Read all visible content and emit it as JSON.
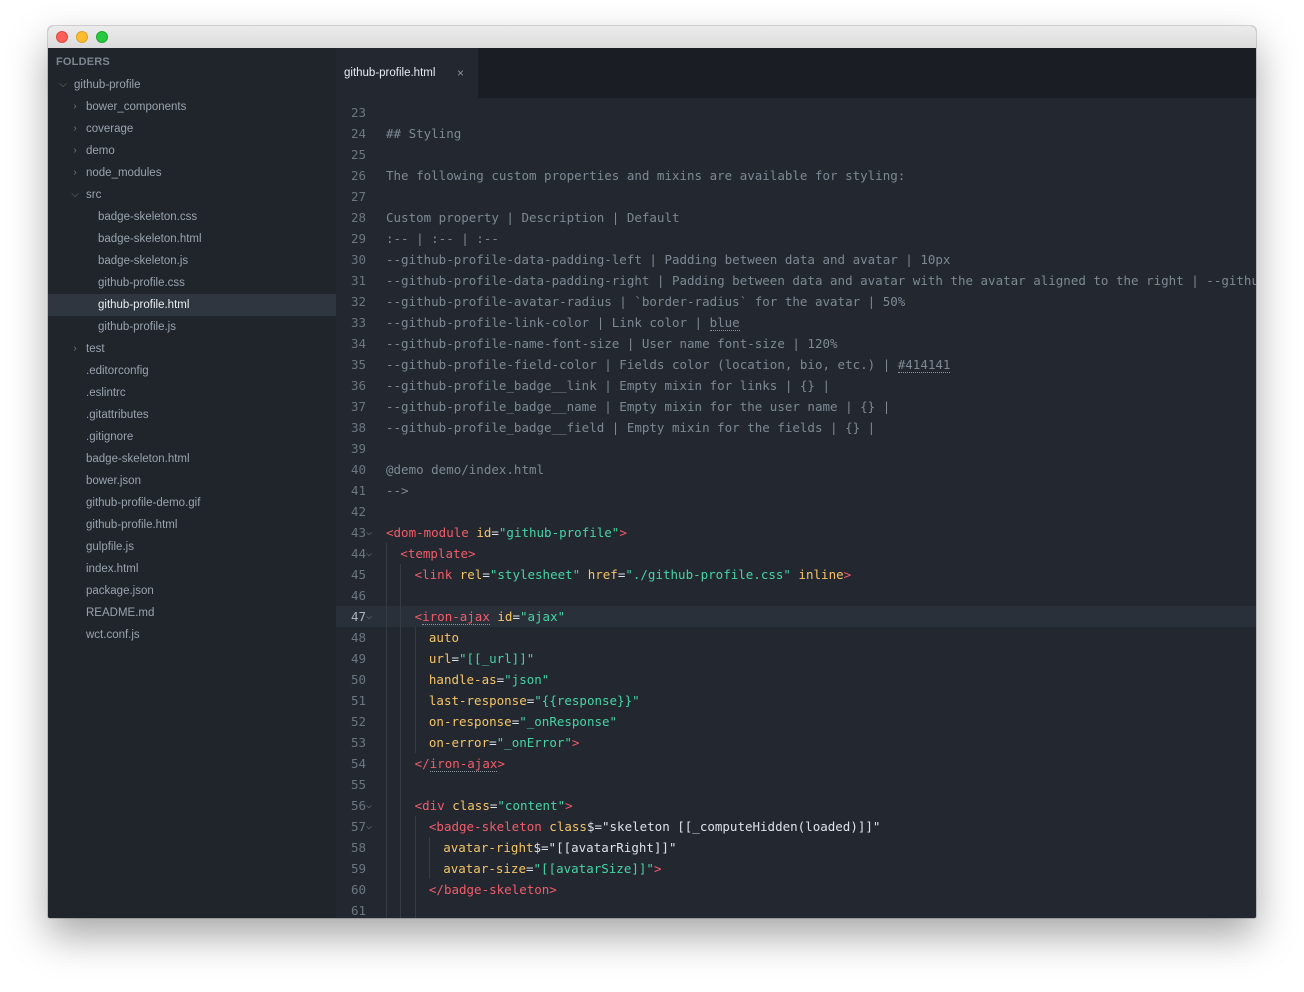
{
  "window": {
    "traffic_lights": [
      "close",
      "minimize",
      "zoom"
    ]
  },
  "sidebar": {
    "header": "FOLDERS",
    "items": [
      {
        "label": "github-profile",
        "depth": 0,
        "type": "folder-open"
      },
      {
        "label": "bower_components",
        "depth": 1,
        "type": "folder-closed"
      },
      {
        "label": "coverage",
        "depth": 1,
        "type": "folder-closed"
      },
      {
        "label": "demo",
        "depth": 1,
        "type": "folder-closed"
      },
      {
        "label": "node_modules",
        "depth": 1,
        "type": "folder-closed"
      },
      {
        "label": "src",
        "depth": 1,
        "type": "folder-open"
      },
      {
        "label": "badge-skeleton.css",
        "depth": 2,
        "type": "file"
      },
      {
        "label": "badge-skeleton.html",
        "depth": 2,
        "type": "file"
      },
      {
        "label": "badge-skeleton.js",
        "depth": 2,
        "type": "file"
      },
      {
        "label": "github-profile.css",
        "depth": 2,
        "type": "file"
      },
      {
        "label": "github-profile.html",
        "depth": 2,
        "type": "file",
        "selected": true
      },
      {
        "label": "github-profile.js",
        "depth": 2,
        "type": "file"
      },
      {
        "label": "test",
        "depth": 1,
        "type": "folder-closed"
      },
      {
        "label": ".editorconfig",
        "depth": 1,
        "type": "file"
      },
      {
        "label": ".eslintrc",
        "depth": 1,
        "type": "file"
      },
      {
        "label": ".gitattributes",
        "depth": 1,
        "type": "file"
      },
      {
        "label": ".gitignore",
        "depth": 1,
        "type": "file"
      },
      {
        "label": "badge-skeleton.html",
        "depth": 1,
        "type": "file"
      },
      {
        "label": "bower.json",
        "depth": 1,
        "type": "file"
      },
      {
        "label": "github-profile-demo.gif",
        "depth": 1,
        "type": "file"
      },
      {
        "label": "github-profile.html",
        "depth": 1,
        "type": "file"
      },
      {
        "label": "gulpfile.js",
        "depth": 1,
        "type": "file"
      },
      {
        "label": "index.html",
        "depth": 1,
        "type": "file"
      },
      {
        "label": "package.json",
        "depth": 1,
        "type": "file"
      },
      {
        "label": "README.md",
        "depth": 1,
        "type": "file"
      },
      {
        "label": "wct.conf.js",
        "depth": 1,
        "type": "file"
      }
    ]
  },
  "tabs": [
    {
      "label": "github-profile.html",
      "close_icon": "×",
      "active": true
    }
  ],
  "editor": {
    "current_line": 47,
    "lines": [
      {
        "n": "23",
        "indent": 0,
        "tokens": []
      },
      {
        "n": "24",
        "indent": 0,
        "tokens": [
          {
            "t": "## Styling",
            "c": "comment"
          }
        ]
      },
      {
        "n": "25",
        "indent": 0,
        "tokens": []
      },
      {
        "n": "26",
        "indent": 0,
        "tokens": [
          {
            "t": "The following custom properties and mixins are available for styling:",
            "c": "comment"
          }
        ]
      },
      {
        "n": "27",
        "indent": 0,
        "tokens": []
      },
      {
        "n": "28",
        "indent": 0,
        "tokens": [
          {
            "t": "Custom property | Description | Default",
            "c": "comment"
          }
        ]
      },
      {
        "n": "29",
        "indent": 0,
        "tokens": [
          {
            "t": ":-- | :-- | :--",
            "c": "comment"
          }
        ]
      },
      {
        "n": "30",
        "indent": 0,
        "tokens": [
          {
            "t": "--github-profile-data-padding-left | Padding between data and avatar | 10px",
            "c": "comment"
          }
        ]
      },
      {
        "n": "31",
        "indent": 0,
        "tokens": [
          {
            "t": "--github-profile-data-padding-right | Padding between data and avatar with the avatar aligned to the right | --github-pro",
            "c": "comment"
          }
        ]
      },
      {
        "n": "32",
        "indent": 0,
        "tokens": [
          {
            "t": "--github-profile-avatar-radius | `border-radius` for the avatar | 50%",
            "c": "comment"
          }
        ]
      },
      {
        "n": "33",
        "indent": 0,
        "tokens": [
          {
            "t": "--github-profile-link-color | Link color | ",
            "c": "comment"
          },
          {
            "t": "blue",
            "c": "comment-u"
          }
        ]
      },
      {
        "n": "34",
        "indent": 0,
        "tokens": [
          {
            "t": "--github-profile-name-font-size | User name font-size | 120%",
            "c": "comment"
          }
        ]
      },
      {
        "n": "35",
        "indent": 0,
        "tokens": [
          {
            "t": "--github-profile-field-color | Fields color (location, bio, etc.) | ",
            "c": "comment"
          },
          {
            "t": "#414141",
            "c": "comment-u"
          }
        ]
      },
      {
        "n": "36",
        "indent": 0,
        "tokens": [
          {
            "t": "--github-profile_badge__link | Empty mixin for links | {} |",
            "c": "comment"
          }
        ]
      },
      {
        "n": "37",
        "indent": 0,
        "tokens": [
          {
            "t": "--github-profile_badge__name | Empty mixin for the user name | {} |",
            "c": "comment"
          }
        ]
      },
      {
        "n": "38",
        "indent": 0,
        "tokens": [
          {
            "t": "--github-profile_badge__field | Empty mixin for the fields | {} |",
            "c": "comment"
          }
        ]
      },
      {
        "n": "39",
        "indent": 0,
        "tokens": []
      },
      {
        "n": "40",
        "indent": 0,
        "tokens": [
          {
            "t": "@demo demo/index.html",
            "c": "comment"
          }
        ]
      },
      {
        "n": "41",
        "indent": 0,
        "tokens": [
          {
            "t": "-->",
            "c": "comment"
          }
        ]
      },
      {
        "n": "42",
        "indent": 0,
        "tokens": []
      },
      {
        "n": "43",
        "indent": 0,
        "fold": true,
        "tokens": [
          {
            "t": "<dom-module",
            "c": "tag"
          },
          {
            "t": " id",
            "c": "attr"
          },
          {
            "t": "=",
            "c": "plain"
          },
          {
            "t": "\"github-profile\"",
            "c": "str"
          },
          {
            "t": ">",
            "c": "tag"
          }
        ]
      },
      {
        "n": "44",
        "indent": 1,
        "fold": true,
        "tokens": [
          {
            "t": "<template>",
            "c": "tag"
          }
        ]
      },
      {
        "n": "45",
        "indent": 2,
        "tokens": [
          {
            "t": "<link",
            "c": "tag"
          },
          {
            "t": " rel",
            "c": "attr"
          },
          {
            "t": "=",
            "c": "plain"
          },
          {
            "t": "\"stylesheet\"",
            "c": "str"
          },
          {
            "t": " href",
            "c": "attr"
          },
          {
            "t": "=",
            "c": "plain"
          },
          {
            "t": "\"./github-profile.css\"",
            "c": "str"
          },
          {
            "t": " inline",
            "c": "attr"
          },
          {
            "t": ">",
            "c": "tag"
          }
        ]
      },
      {
        "n": "46",
        "indent": 2,
        "tokens": []
      },
      {
        "n": "47",
        "indent": 2,
        "fold": true,
        "tokens": [
          {
            "t": "<",
            "c": "tag"
          },
          {
            "t": "iron-ajax",
            "c": "tag-u"
          },
          {
            "t": " id",
            "c": "attr"
          },
          {
            "t": "=",
            "c": "plain"
          },
          {
            "t": "\"ajax\"",
            "c": "str"
          }
        ]
      },
      {
        "n": "48",
        "indent": 3,
        "tokens": [
          {
            "t": "auto",
            "c": "attr"
          }
        ]
      },
      {
        "n": "49",
        "indent": 3,
        "tokens": [
          {
            "t": "url",
            "c": "attr"
          },
          {
            "t": "=",
            "c": "plain"
          },
          {
            "t": "\"[[_url]]\"",
            "c": "str"
          }
        ]
      },
      {
        "n": "50",
        "indent": 3,
        "tokens": [
          {
            "t": "handle-as",
            "c": "attr"
          },
          {
            "t": "=",
            "c": "plain"
          },
          {
            "t": "\"json\"",
            "c": "str"
          }
        ]
      },
      {
        "n": "51",
        "indent": 3,
        "tokens": [
          {
            "t": "last-response",
            "c": "attr"
          },
          {
            "t": "=",
            "c": "plain"
          },
          {
            "t": "\"{{response}}\"",
            "c": "str"
          }
        ]
      },
      {
        "n": "52",
        "indent": 3,
        "tokens": [
          {
            "t": "on-response",
            "c": "attr"
          },
          {
            "t": "=",
            "c": "plain"
          },
          {
            "t": "\"_onResponse\"",
            "c": "str"
          }
        ]
      },
      {
        "n": "53",
        "indent": 3,
        "tokens": [
          {
            "t": "on-error",
            "c": "attr"
          },
          {
            "t": "=",
            "c": "plain"
          },
          {
            "t": "\"_onError\"",
            "c": "str"
          },
          {
            "t": ">",
            "c": "tag"
          }
        ]
      },
      {
        "n": "54",
        "indent": 2,
        "tokens": [
          {
            "t": "</",
            "c": "tag"
          },
          {
            "t": "iron-ajax",
            "c": "tag-u"
          },
          {
            "t": ">",
            "c": "tag"
          }
        ]
      },
      {
        "n": "55",
        "indent": 2,
        "tokens": []
      },
      {
        "n": "56",
        "indent": 2,
        "fold": true,
        "tokens": [
          {
            "t": "<div",
            "c": "tag"
          },
          {
            "t": " class",
            "c": "attr"
          },
          {
            "t": "=",
            "c": "plain"
          },
          {
            "t": "\"content\"",
            "c": "str"
          },
          {
            "t": ">",
            "c": "tag"
          }
        ]
      },
      {
        "n": "57",
        "indent": 3,
        "fold": true,
        "tokens": [
          {
            "t": "<badge-skeleton",
            "c": "tag"
          },
          {
            "t": " class",
            "c": "attr"
          },
          {
            "t": "$=\"skeleton [[_computeHidden(loaded)]]\"",
            "c": "plain"
          }
        ]
      },
      {
        "n": "58",
        "indent": 4,
        "tokens": [
          {
            "t": "avatar-right",
            "c": "attr"
          },
          {
            "t": "$=\"[[avatarRight]]\"",
            "c": "plain"
          }
        ]
      },
      {
        "n": "59",
        "indent": 4,
        "tokens": [
          {
            "t": "avatar-size",
            "c": "attr"
          },
          {
            "t": "=",
            "c": "plain"
          },
          {
            "t": "\"[[avatarSize]]\"",
            "c": "str"
          },
          {
            "t": ">",
            "c": "tag"
          }
        ]
      },
      {
        "n": "60",
        "indent": 3,
        "tokens": [
          {
            "t": "</badge-skeleton>",
            "c": "tag"
          }
        ]
      },
      {
        "n": "61",
        "indent": 3,
        "tokens": []
      }
    ]
  }
}
